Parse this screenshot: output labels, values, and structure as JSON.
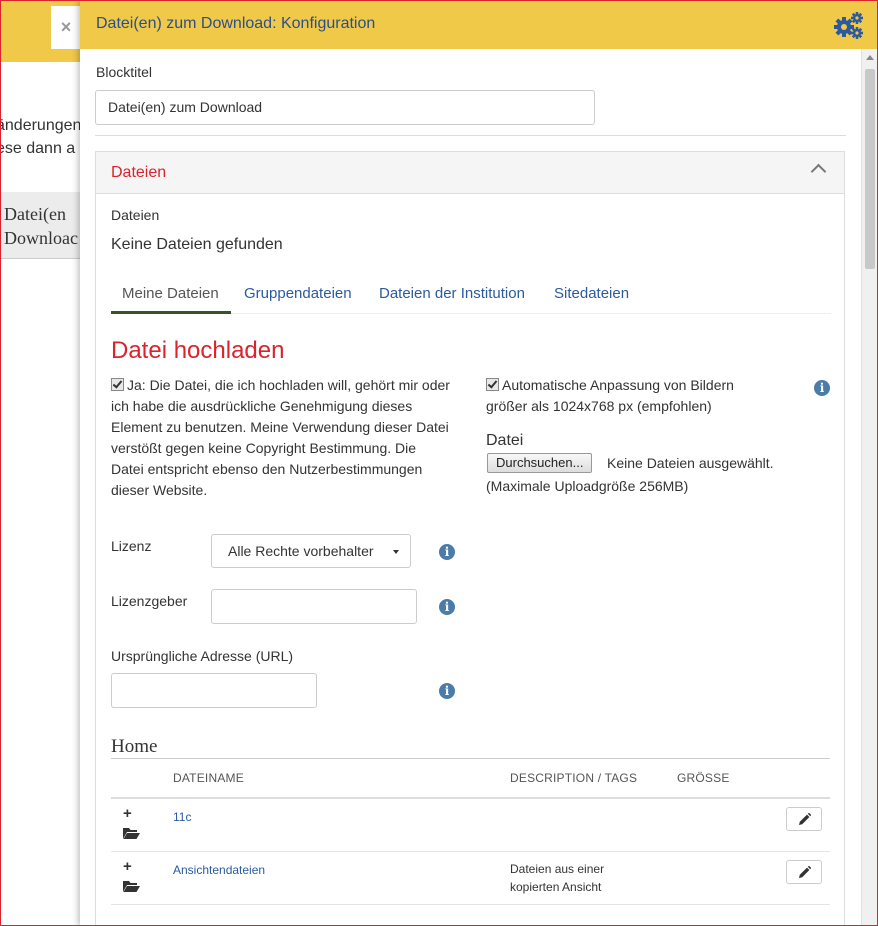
{
  "background": {
    "close_label": "×",
    "line1": "änderungen",
    "line2": "ese dann a",
    "block_line1": "Datei(en",
    "block_line2": "Downloac"
  },
  "panel": {
    "title": "Datei(en) zum Download: Konfiguration",
    "gear_icon": "gears-icon",
    "accent_color": "#f0c948",
    "title_color": "#2b4f8c"
  },
  "form": {
    "block_title_label": "Blocktitel",
    "block_title_value": "Datei(en) zum Download"
  },
  "files_section": {
    "title": "Dateien",
    "title_color": "#d9232d",
    "files_label": "Dateien",
    "no_files": "Keine Dateien gefunden",
    "tabs": [
      {
        "label": "Meine Dateien",
        "active": true
      },
      {
        "label": "Gruppendateien",
        "active": false
      },
      {
        "label": "Dateien der Institution",
        "active": false
      },
      {
        "label": "Sitedateien",
        "active": false
      }
    ]
  },
  "upload": {
    "heading": "Datei hochladen",
    "agreement_checked": true,
    "agreement_text": "Ja: Die Datei, die ich hochladen will, gehört mir oder ich habe die ausdrückliche Genehmigung dieses Element zu benutzen. Meine Verwendung dieser Datei verstößt gegen keine Copyright Bestimmung. Die Datei entspricht ebenso den Nutzerbestimmungen dieser Website.",
    "resize_checked": true,
    "resize_text": "Automatische Anpassung von Bildern größer als 1024x768 px (empfohlen)",
    "file_label": "Datei",
    "browse_button": "Durchsuchen...",
    "no_file_selected": "Keine Dateien ausgewählt.",
    "max_size": "(Maximale Uploadgröße 256MB)",
    "license_label": "Lizenz",
    "license_value": "Alle Rechte vorbehalter",
    "licensor_label": "Lizenzgeber",
    "licensor_value": "",
    "original_url_label": "Ursprüngliche Adresse (URL)",
    "original_url_value": ""
  },
  "browser": {
    "folder_title": "Home",
    "columns": [
      "DATEINAME",
      "DESCRIPTION / TAGS",
      "GRÖSSE"
    ],
    "rows": [
      {
        "name": "11c",
        "description": "",
        "size": ""
      },
      {
        "name": "Ansichtendateien",
        "description": "Dateien aus einer kopierten Ansicht",
        "size": ""
      }
    ]
  }
}
